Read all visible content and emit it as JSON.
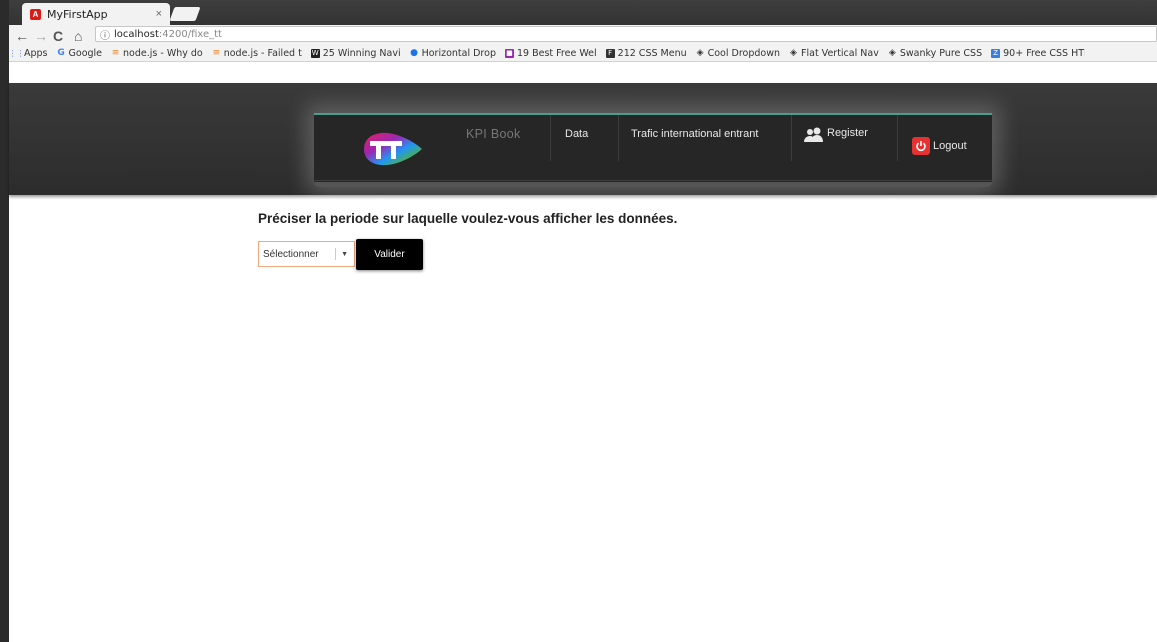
{
  "browser": {
    "tab_title": "MyFirstApp",
    "tab_close": "×",
    "url_host": "localhost",
    "url_path": ":4200/fixe_tt",
    "bookmarks": [
      {
        "label": "Apps",
        "icon": "apps-grid-icon",
        "color": "#4285f4"
      },
      {
        "label": "Google",
        "icon": "google-icon",
        "color": "#ffffff"
      },
      {
        "label": "node.js - Why do",
        "icon": "stackoverflow-icon",
        "color": "#f48024"
      },
      {
        "label": "node.js - Failed t",
        "icon": "stackoverflow-icon",
        "color": "#f48024"
      },
      {
        "label": "25 Winning Navi",
        "icon": "w-icon",
        "color": "#222222"
      },
      {
        "label": "Horizontal Drop",
        "icon": "circle-icon",
        "color": "#1a73e8"
      },
      {
        "label": "19 Best Free Wel",
        "icon": "square-icon",
        "color": "#9b27b0"
      },
      {
        "label": "212 CSS Menu",
        "icon": "f-icon",
        "color": "#333333"
      },
      {
        "label": "Cool Dropdown",
        "icon": "codepen-icon",
        "color": "#333333"
      },
      {
        "label": "Flat Vertical Nav",
        "icon": "codepen-icon",
        "color": "#333333"
      },
      {
        "label": "Swanky Pure CSS",
        "icon": "codepen-icon",
        "color": "#333333"
      },
      {
        "label": "90+ Free CSS HTI",
        "icon": "z-icon",
        "color": "#3b7ddd"
      }
    ]
  },
  "header": {
    "brand": "KPI Book",
    "nav": {
      "data": "Data",
      "trafic": "Trafic international entrant",
      "register": "Register",
      "logout": "Logout"
    },
    "accent_color": "#4b9e8b"
  },
  "main": {
    "title": "Préciser la periode sur laquelle voulez-vous afficher les données.",
    "select_label": "Sélectionner",
    "submit_label": "Valider"
  }
}
